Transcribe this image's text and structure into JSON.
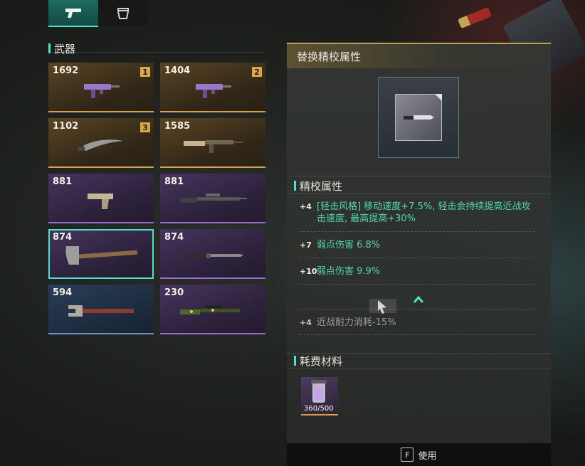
{
  "tabs": [
    {
      "icon": "pistol-icon",
      "active": true
    },
    {
      "icon": "helmet-icon",
      "active": false
    }
  ],
  "weapons_section": {
    "title": "武器"
  },
  "weapons": [
    {
      "power": "1692",
      "slot": "1",
      "rarity": "gold",
      "icon": "smg-icon"
    },
    {
      "power": "1404",
      "slot": "2",
      "rarity": "gold",
      "icon": "smg-icon"
    },
    {
      "power": "1102",
      "slot": "3",
      "rarity": "gold",
      "icon": "blade-icon"
    },
    {
      "power": "1585",
      "slot": "",
      "rarity": "gold",
      "icon": "rifle-icon"
    },
    {
      "power": "881",
      "slot": "",
      "rarity": "purple",
      "icon": "pistol-icon"
    },
    {
      "power": "881",
      "slot": "",
      "rarity": "purple",
      "icon": "sniper-rifle-icon"
    },
    {
      "power": "874",
      "slot": "",
      "rarity": "purple",
      "icon": "axe-icon",
      "selected": true
    },
    {
      "power": "874",
      "slot": "",
      "rarity": "purple",
      "icon": "bayonet-icon"
    },
    {
      "power": "594",
      "slot": "",
      "rarity": "blue",
      "icon": "wrench-icon"
    },
    {
      "power": "230",
      "slot": "",
      "rarity": "purple",
      "icon": "camo-rifle-icon"
    }
  ],
  "panel": {
    "title": "替换精校属性",
    "preview_icon": "knife-icon",
    "attributes_title": "精校属性",
    "attributes": [
      {
        "level": "+4",
        "text": "[轻击风格] 移动速度+7.5%, 轻击会持续提高近战攻击速度, 最高提高+30%",
        "dim": false
      },
      {
        "level": "+7",
        "text": "弱点伤害 6.8%",
        "dim": false
      },
      {
        "level": "+10",
        "text": "弱点伤害 9.9%",
        "dim": false
      },
      {
        "level": "+4",
        "text": "近战耐力消耗-15%",
        "dim": true
      }
    ],
    "cost_title": "耗费材料",
    "material": {
      "count": "360/500",
      "icon": "vial-icon"
    }
  },
  "footer": {
    "key": "F",
    "label": "使用"
  },
  "colors": {
    "accent": "#4fe0c9",
    "gold": "#d6a24a",
    "purple": "#9a6ad0",
    "blue": "#6b93c4",
    "attr_text": "#53d6b0"
  }
}
